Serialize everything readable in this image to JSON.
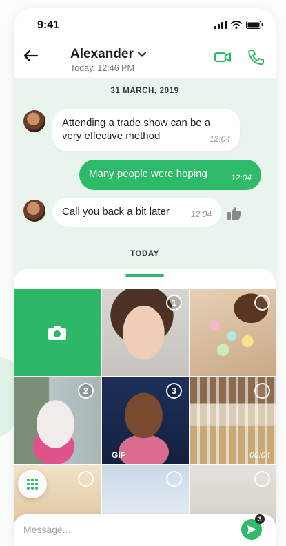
{
  "status_bar": {
    "time": "9:41"
  },
  "header": {
    "contact_name": "Alexander",
    "last_seen": "Today, 12:46 PM"
  },
  "conversation": {
    "date_divider": "31 MARCH, 2019",
    "messages": [
      {
        "direction": "incoming",
        "text": "Attending a trade show can be a very effective method",
        "time": "12:04"
      },
      {
        "direction": "outgoing",
        "text": "Many people were hoping",
        "time": "12:04"
      },
      {
        "direction": "incoming",
        "text": "Call you back a bit later",
        "time": "12:04"
      }
    ],
    "today_divider": "TODAY"
  },
  "gallery": {
    "selection": [
      "1",
      "2",
      "3"
    ],
    "gif_label": "GIF",
    "video_duration": "00:04"
  },
  "composer": {
    "placeholder": "Message...",
    "send_badge": "3"
  },
  "colors": {
    "accent": "#2dbb6a",
    "chat_background": "#e8f4ec"
  }
}
